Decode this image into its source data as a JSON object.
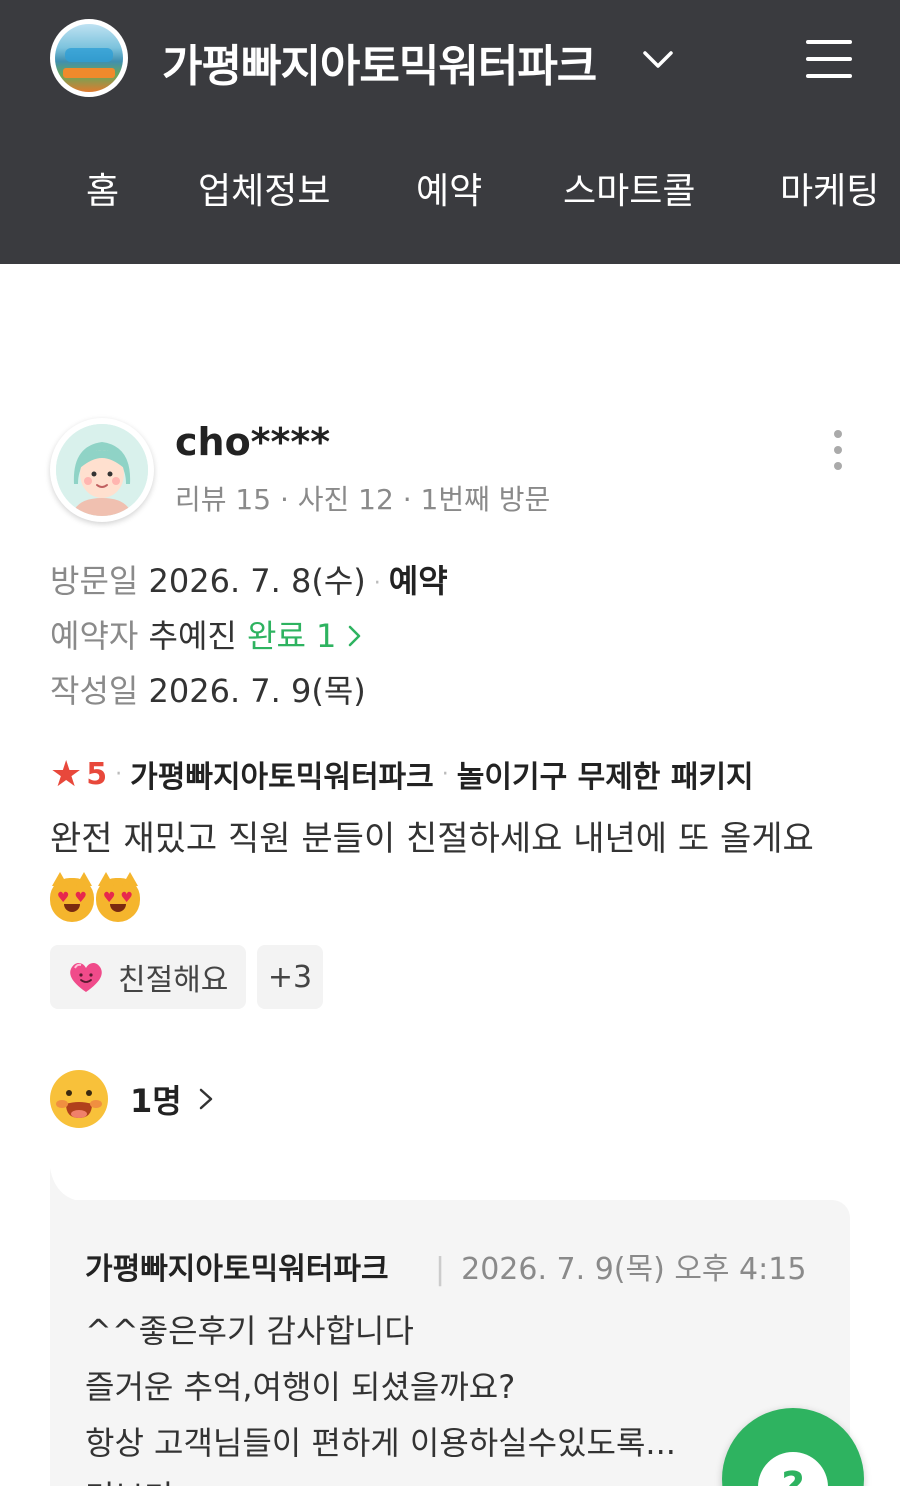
{
  "header": {
    "business_name": "가평빠지아토믹워터파크",
    "tabs": [
      {
        "label": "홈"
      },
      {
        "label": "업체정보"
      },
      {
        "label": "예약"
      },
      {
        "label": "스마트콜"
      },
      {
        "label": "마케팅"
      }
    ]
  },
  "review": {
    "user_name": "cho****",
    "user_meta": "리뷰 15 · 사진 12 · 1번째 방문",
    "visit_label": "방문일",
    "visit_date": "2026. 7. 8(수)",
    "visit_type": "예약",
    "booker_label": "예약자",
    "booker_name": "추예진",
    "booker_status": "완료 1",
    "written_label": "작성일",
    "written_date": "2026. 7. 9(목)",
    "rating": "5",
    "place": "가평빠지아토믹워터파크",
    "product": "놀이기구 무제한 패키지",
    "text": "완전 재밌고 직원 분들이 친절하세요 내년에 또 올게요",
    "tag_label": "친절해요",
    "tag_more": "+3",
    "likes": "1명"
  },
  "reply": {
    "name": "가평빠지아토믹워터파크",
    "date": "2026. 7. 9(목) 오후 4:15",
    "line1": "^^좋은후기 감사합니다",
    "line2": "즐거운 추억,여행이 되셨을까요?",
    "line3": "항상 고객님들이 편하게 이용하실수있도록...",
    "more": "더보기"
  },
  "colors": {
    "header_bg": "#3a3b3f",
    "accent_green": "#2eb360",
    "star_red": "#e8483b"
  }
}
